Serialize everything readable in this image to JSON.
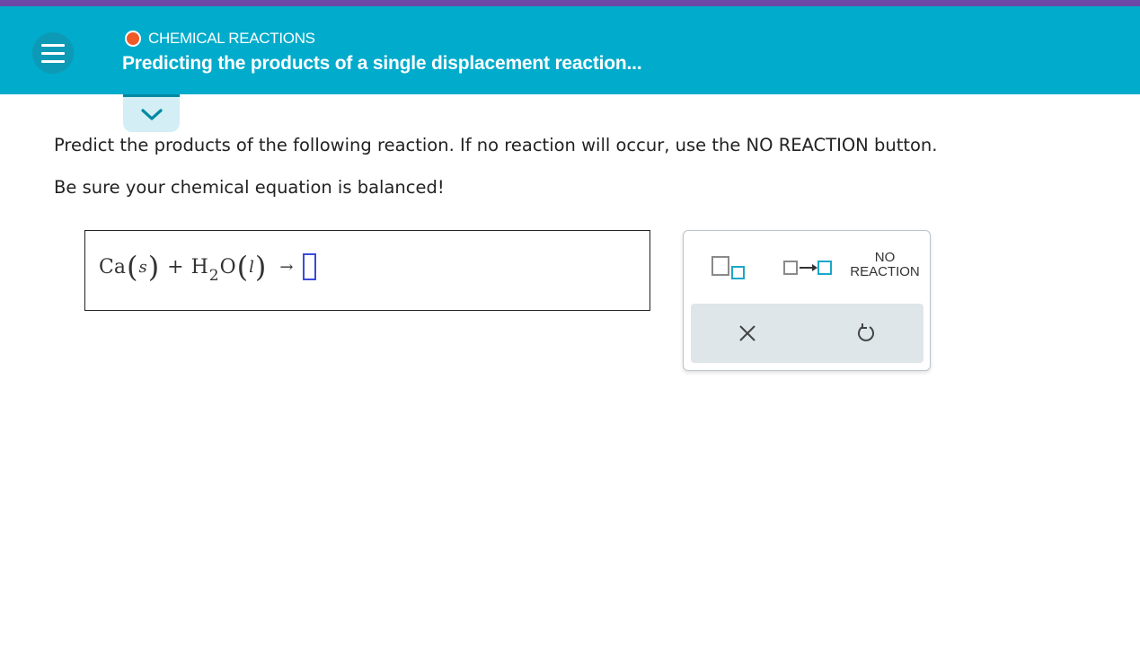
{
  "header": {
    "topic": "CHEMICAL REACTIONS",
    "title": "Predicting the products of a single displacement reaction...",
    "menu_icon": "hamburger-menu-icon",
    "collapse_icon": "chevron-down-icon"
  },
  "prompt": {
    "line1": "Predict the products of the following reaction. If no reaction will occur, use the NO REACTION button.",
    "line2": "Be sure your chemical equation is balanced!"
  },
  "equation": {
    "reactant1": "Ca",
    "reactant1_state": "s",
    "plus": "+",
    "reactant2_h": "H",
    "reactant2_sub": "2",
    "reactant2_o": "O",
    "reactant2_state": "l",
    "arrow": "→"
  },
  "tools": {
    "subscript_icon": "subscript-template-icon",
    "reaction_arrow_icon": "reaction-arrow-template-icon",
    "no_reaction_line1": "NO",
    "no_reaction_line2": "REACTION",
    "clear_icon": "x-clear-icon",
    "undo_icon": "undo-icon"
  },
  "colors": {
    "header_bg": "#00abcb",
    "top_strip": "#6d48a6",
    "topic_dot": "#f05a28",
    "input_slot": "#3b4bd8",
    "tool_accent": "#1aa7c9"
  }
}
